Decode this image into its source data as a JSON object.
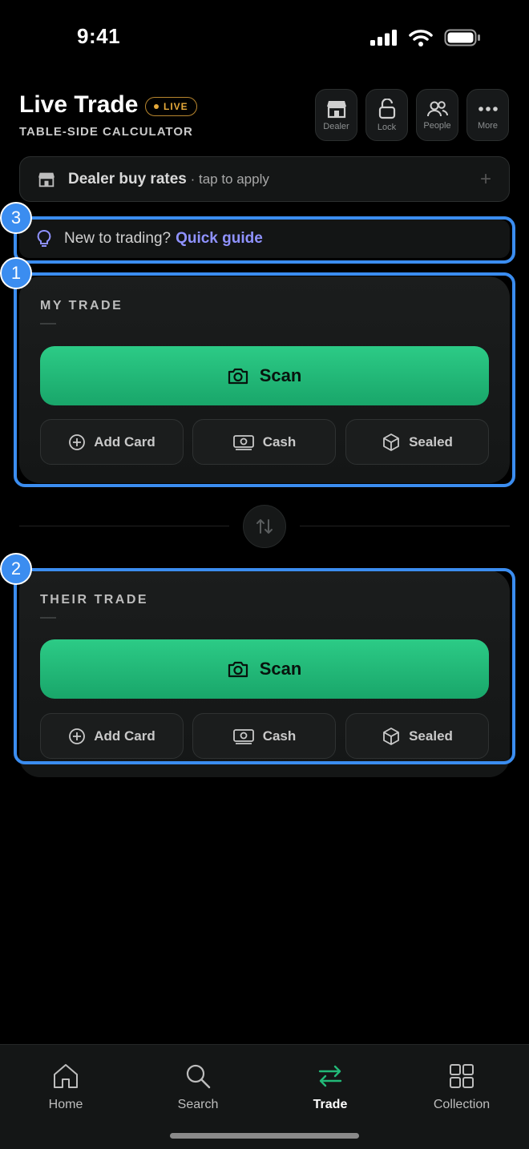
{
  "status": {
    "time": "9:41"
  },
  "header": {
    "title": "Live Trade",
    "live_badge": "LIVE",
    "subtitle": "TABLE-SIDE CALCULATOR"
  },
  "header_buttons": [
    {
      "label": "Dealer",
      "icon": "store-icon"
    },
    {
      "label": "Lock",
      "icon": "unlock-icon"
    },
    {
      "label": "People",
      "icon": "people-icon"
    },
    {
      "label": "More",
      "icon": "more-icon"
    }
  ],
  "dealer_bar": {
    "title": "Dealer buy rates",
    "separator": " · ",
    "hint": "tap to apply",
    "plus": "+"
  },
  "guide": {
    "prompt": "New to trading?",
    "link": "Quick guide"
  },
  "my_trade": {
    "label": "MY TRADE",
    "scan": "Scan",
    "add_card": "Add Card",
    "cash": "Cash",
    "sealed": "Sealed"
  },
  "their_trade": {
    "label": "THEIR TRADE",
    "scan": "Scan",
    "add_card": "Add Card",
    "cash": "Cash",
    "sealed": "Sealed"
  },
  "annotations": [
    "1",
    "2",
    "3"
  ],
  "tabs": [
    {
      "label": "Home",
      "icon": "home-icon"
    },
    {
      "label": "Search",
      "icon": "search-icon"
    },
    {
      "label": "Trade",
      "icon": "trade-arrows-icon",
      "active": true
    },
    {
      "label": "Collection",
      "icon": "grid-icon"
    }
  ],
  "colors": {
    "accent_green": "#22b978",
    "live_orange": "#e5a93a",
    "link_purple": "#8f92ff",
    "annotation_blue": "#3b8df0"
  }
}
